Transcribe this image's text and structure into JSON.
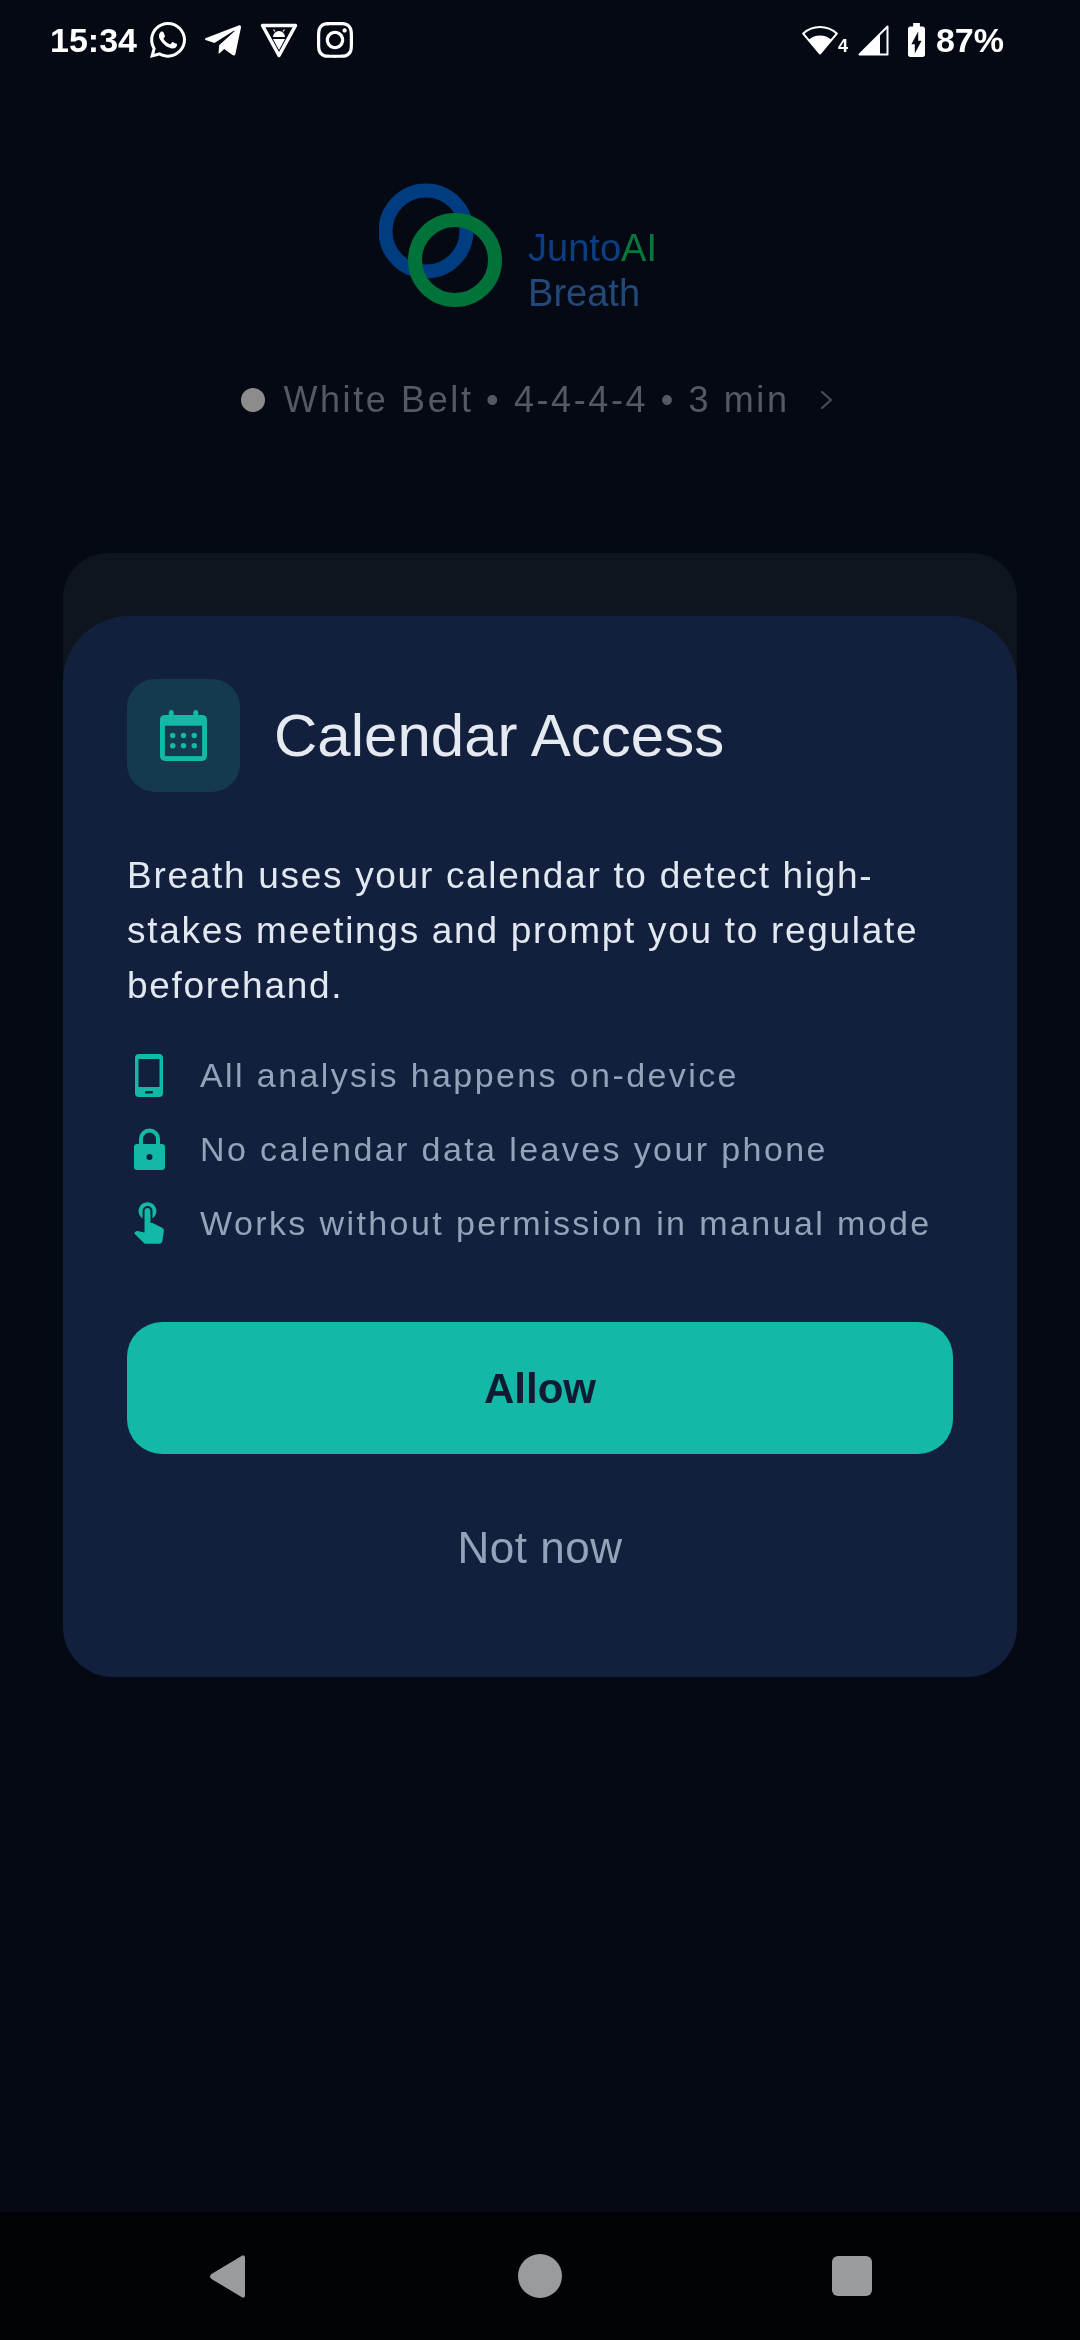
{
  "status_bar": {
    "time": "15:34",
    "wifi_label": "4",
    "charging": true,
    "battery": "87%"
  },
  "logo": {
    "name_parts": [
      "Junto",
      "AI"
    ],
    "subtitle": "Breath"
  },
  "session": {
    "color": "#8c8c8c",
    "summary": "White Belt • 4-4-4-4 • 3 min"
  },
  "dialog": {
    "title": "Calendar Access",
    "body": "Breath uses your calendar to detect high-stakes meetings and prompt you to regulate beforehand.",
    "points": [
      {
        "kind": "device",
        "text": "All analysis happens on-device"
      },
      {
        "kind": "privacy",
        "text": "No calendar data leaves your phone"
      },
      {
        "kind": "manual",
        "text": "Works without permission in manual mode"
      }
    ],
    "buttons": [
      {
        "kind": "primary",
        "label": "Allow"
      },
      {
        "kind": "secondary",
        "label": "Not now"
      }
    ]
  }
}
